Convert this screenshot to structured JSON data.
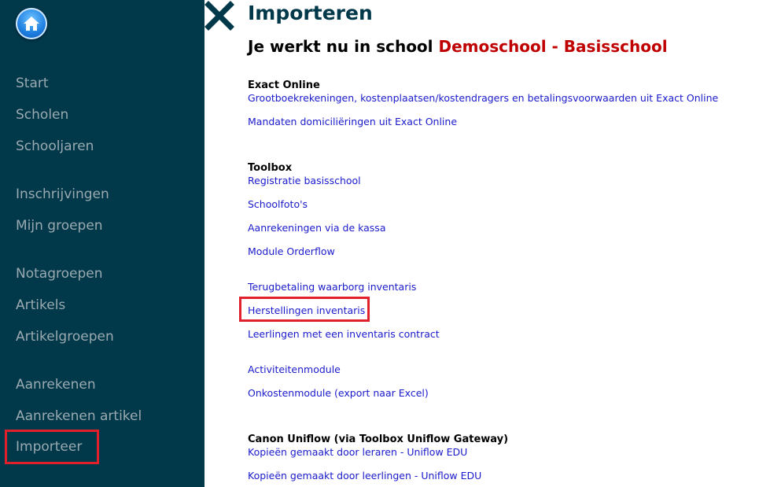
{
  "sidebar": {
    "items": [
      {
        "label": "Start"
      },
      {
        "label": "Scholen"
      },
      {
        "label": "Schooljaren"
      },
      {
        "label": "Inschrijvingen"
      },
      {
        "label": "Mijn groepen"
      },
      {
        "label": "Notagroepen"
      },
      {
        "label": "Artikels"
      },
      {
        "label": "Artikelgroepen"
      },
      {
        "label": "Aanrekenen"
      },
      {
        "label": "Aanrekenen artikel"
      },
      {
        "label": "Importeer"
      }
    ]
  },
  "main": {
    "title": "Importeren",
    "subtitle_prefix": "Je werkt nu in school",
    "school_name": "Demoschool - Basisschool",
    "sections": [
      {
        "heading": "Exact Online",
        "links": [
          "Grootboekrekeningen, kostenplaatsen/kostendragers en betalingsvoorwaarden uit Exact Online",
          "Mandaten domiciliëringen uit Exact Online"
        ]
      },
      {
        "heading": "Toolbox",
        "links": [
          "Registratie basisschool",
          "Schoolfoto's",
          "Aanrekeningen via de kassa",
          "Module Orderflow",
          "Terugbetaling waarborg inventaris",
          "Herstellingen inventaris",
          "Leerlingen met een inventaris contract",
          "Activiteitenmodule",
          "Onkostenmodule (export naar Excel)"
        ]
      },
      {
        "heading": "Canon Uniflow (via Toolbox Uniflow Gateway)",
        "links": [
          "Kopieën gemaakt door leraren - Uniflow EDU",
          "Kopieën gemaakt door leerlingen - Uniflow EDU"
        ]
      }
    ]
  },
  "colors": {
    "sidebar_bg": "#01384a",
    "sidebar_text": "#9aaab0",
    "title": "#01384a",
    "school_name": "#c00000",
    "link": "#1a1acc",
    "highlight": "#e0202a"
  },
  "icons": {
    "home": "home-icon",
    "close": "close-icon"
  }
}
